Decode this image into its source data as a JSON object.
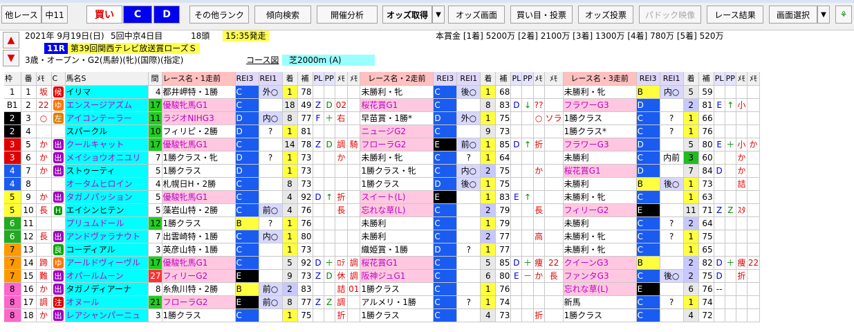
{
  "toolbar": {
    "other_race": "他レース",
    "course_code": "中11",
    "buy": "買い",
    "c": "C",
    "d": "D",
    "other_rank": "その他ランク",
    "trend_search": "傾向検索",
    "meeting_analysis": "開催分析",
    "odds_get": "オッズ取得",
    "odds_screen": "オッズ画面",
    "buy_vote": "買い目・投票",
    "odds_vote": "オッズ投票",
    "paddock": "パドック映像",
    "result": "レース結果",
    "screen_select": "画面選択",
    "dropdown_arrow": "▼"
  },
  "race": {
    "date": "2021年 9月19日(日)",
    "meeting": "5回中京4日目",
    "heads": "18頭",
    "post_time": "15:35発走",
    "race_no": "11R",
    "name": "第39回関西テレビ放送賞ローズＳ",
    "conditions": "3歳・オープン・G2(馬齢)(牝)(国際)(指定)",
    "course_label": "コース図",
    "course": "芝2000m (A)",
    "prize": "本賞金 [1着] 5200万 [2着] 2100万 [3着] 1300万 [4着] 780万 [5着] 520万"
  },
  "headers": [
    "枠",
    "番",
    "ﾒﾓ",
    "C",
    "馬名S",
    "間",
    "レース名・1走前",
    "REI3",
    "REI1",
    "着",
    "補",
    "PL",
    "PP",
    "ﾒﾓ",
    "ﾒﾓ",
    "レース名・2走前",
    "REI3",
    "REI1",
    "着",
    "補",
    "PL",
    "PP",
    "ﾒﾓ",
    "ﾒﾓ",
    "レース名・3走前",
    "REI3",
    "REI1",
    "着",
    "補",
    "PL",
    "PP",
    "ﾒﾓ",
    "ﾒﾓ"
  ],
  "rows": [
    {
      "w": "1",
      "n": "1",
      "m": "坂",
      "c": "候",
      "name": "イリマ",
      "gap": "4",
      "r1": [
        "都井岬特・1勝",
        "C",
        "外○",
        "1",
        "78",
        "",
        "",
        "",
        ""
      ],
      "r2": [
        "未勝利・牝",
        "C",
        "後○",
        "1",
        "68",
        "",
        "",
        "",
        ""
      ],
      "r3": [
        "未勝利・牝",
        "B",
        "内○",
        "5",
        "59",
        "",
        "",
        "",
        ""
      ]
    },
    {
      "w": "B1",
      "n": "2",
      "m": "22",
      "c": "ゆ",
      "name": "エンスージアズム",
      "gap": "17",
      "r1": [
        "優駿牝馬G1",
        "C",
        "",
        "18",
        "49",
        "Z",
        "D",
        "02",
        ""
      ],
      "r2": [
        "桜花賞G1",
        "C",
        "",
        "8",
        "83",
        "D",
        "↓",
        "??",
        ""
      ],
      "r3": [
        "フラワーG3",
        "D",
        "",
        "2",
        "81",
        "E",
        "↑",
        "小",
        ""
      ]
    },
    {
      "w": "2",
      "n": "3",
      "m": "○",
      "c": "左",
      "name": "アイコンテーラー",
      "gap": "11",
      "r1": [
        "ラジオNIHG3",
        "D",
        "内○",
        "8",
        "77",
        "F",
        "＋",
        "右",
        ""
      ],
      "r2": [
        "早苗賞・1勝*",
        "D",
        "外○",
        "1",
        "75",
        "",
        "",
        "○",
        "ソラ"
      ],
      "r3": [
        "1勝クラス",
        "C",
        "?",
        "1",
        "66",
        "",
        "",
        "",
        ""
      ]
    },
    {
      "w": "2",
      "n": "4",
      "m": "",
      "c": "",
      "name": "スパークル",
      "gap": "10",
      "r1": [
        "フィリピ・2勝",
        "D",
        "?",
        "1",
        "81",
        "",
        "",
        "",
        ""
      ],
      "r2": [
        "ニュージG2",
        "C",
        "",
        "9",
        "73",
        "",
        "",
        "",
        ""
      ],
      "r3": [
        "1勝クラス*",
        "C",
        "?",
        "1",
        "76",
        "",
        "",
        "",
        ""
      ]
    },
    {
      "w": "3",
      "n": "5",
      "m": "か",
      "c": "出",
      "name": "クールキャット",
      "gap": "17",
      "r1": [
        "優駿牝馬G1",
        "C",
        "",
        "14",
        "78",
        "Z",
        "D",
        "調",
        "騎"
      ],
      "r2": [
        "フローラG2",
        "E",
        "前○",
        "1",
        "85",
        "D",
        "↑",
        "折",
        ""
      ],
      "r3": [
        "フラワーG3",
        "D",
        "",
        "5",
        "80",
        "E",
        "＋",
        "小",
        "か"
      ]
    },
    {
      "w": "3",
      "n": "6",
      "m": "か",
      "c": "出",
      "name": "メイショウオニユリ",
      "gap": "7",
      "r1": [
        "1勝クラス・牝",
        "D",
        "?",
        "1",
        "73",
        "",
        "",
        "か",
        ""
      ],
      "r2": [
        "未勝利・牝",
        "C",
        "?",
        "1",
        "64",
        "",
        "",
        "",
        ""
      ],
      "r3": [
        "未勝利",
        "C",
        "内前",
        "3",
        "60",
        "",
        "",
        "か",
        ""
      ]
    },
    {
      "w": "4",
      "n": "7",
      "m": "か",
      "c": "出",
      "name": "ストゥーティ",
      "gap": "5",
      "r1": [
        "1勝クラス",
        "D",
        "",
        "1",
        "73",
        "",
        "",
        "",
        ""
      ],
      "r2": [
        "1勝クラス・牝",
        "C",
        "内○",
        "2",
        "75",
        "",
        "",
        "か",
        ""
      ],
      "r3": [
        "桜花賞G1",
        "D",
        "",
        "7",
        "84",
        "D",
        "",
        "か",
        ""
      ]
    },
    {
      "w": "4",
      "n": "8",
      "m": "",
      "c": "",
      "name": "オータムヒロイン",
      "gap": "4",
      "r1": [
        "札幌日H・2勝",
        "C",
        "",
        "8",
        "73",
        "",
        "",
        "",
        ""
      ],
      "r2": [
        "1勝クラス",
        "D",
        "後○",
        "1",
        "75",
        "",
        "",
        "",
        ""
      ],
      "r3": [
        "未勝利",
        "B",
        "後○",
        "1",
        "73",
        "",
        "",
        "詰",
        ""
      ]
    },
    {
      "w": "5",
      "n": "9",
      "m": "か",
      "c": "出",
      "name": "タガノパッション",
      "gap": "5",
      "r1": [
        "優駿牝馬G1",
        "C",
        "",
        "4",
        "92",
        "D",
        "↑",
        "折",
        ""
      ],
      "r2": [
        "スイート(L)",
        "E",
        "",
        "1",
        "83",
        "E",
        "↑",
        "",
        ""
      ],
      "r3": [
        "未勝利・牝",
        "C",
        "",
        "1",
        "63",
        "",
        "",
        "",
        ""
      ]
    },
    {
      "w": "5",
      "n": "10",
      "m": "長",
      "c": "H",
      "name": "エイシンヒテン",
      "gap": "5",
      "r1": [
        "藻岩山特・2勝",
        "C",
        "前○",
        "4",
        "76",
        "",
        "",
        "長",
        ""
      ],
      "r2": [
        "忘れな草(L)",
        "C",
        "",
        "2",
        "79",
        "",
        "",
        "長",
        ""
      ],
      "r3": [
        "フィリーG2",
        "E",
        "",
        "11",
        "71",
        "Z",
        "Z",
        "ｽﾀ",
        ""
      ]
    },
    {
      "w": "6",
      "n": "11",
      "m": "",
      "c": "",
      "name": "プリュムドール",
      "gap": "12",
      "r1": [
        "1勝クラス",
        "B",
        "?",
        "1",
        "76",
        "",
        "",
        "",
        ""
      ],
      "r2": [
        "未勝利",
        "C",
        "",
        "1",
        "79",
        "",
        "",
        "",
        ""
      ],
      "r3": [
        "未勝利",
        "C",
        "?",
        "2",
        "64",
        "",
        "",
        "",
        ""
      ]
    },
    {
      "w": "6",
      "n": "12",
      "m": "長",
      "c": "出",
      "name": "アンドヴァラナウト",
      "gap": "7",
      "r1": [
        "出雲崎特・1勝",
        "C",
        "内○",
        "1",
        "80",
        "",
        "",
        "",
        ""
      ],
      "r2": [
        "未勝利",
        "C",
        "",
        "2",
        "77",
        "",
        "",
        "高",
        ""
      ],
      "r3": [
        "未勝利・牝",
        "C",
        "?",
        "1",
        "75",
        "",
        "",
        "",
        ""
      ]
    },
    {
      "w": "7",
      "n": "13",
      "m": "",
      "c": "良",
      "name": "コーディアル",
      "gap": "3",
      "r1": [
        "英彦山特・1勝",
        "C",
        "",
        "1",
        "73",
        "",
        "",
        "",
        ""
      ],
      "r2": [
        "織姫賞・1勝",
        "D",
        "?",
        "1",
        "77",
        "",
        "",
        "",
        ""
      ],
      "r3": [
        "未勝利・牝",
        "C",
        "",
        "1",
        "65",
        "",
        "",
        "",
        ""
      ]
    },
    {
      "w": "7",
      "n": "14",
      "m": "蹄",
      "c": "ゆ",
      "name": "アールドヴィーヴル",
      "gap": "17",
      "r1": [
        "優駿牝馬G1",
        "C",
        "",
        "5",
        "92",
        "D",
        "＋",
        "ﾛﾃ",
        "調"
      ],
      "r2": [
        "桜花賞G1",
        "C",
        "",
        "5",
        "85",
        "D",
        "＋",
        "痩",
        "22"
      ],
      "r3": [
        "クイーンG3",
        "B",
        "",
        "2",
        "82",
        "D",
        "＋",
        "痩",
        "22"
      ]
    },
    {
      "w": "7",
      "n": "15",
      "m": "難",
      "c": "出",
      "name": "オパールムーン",
      "gap": "27",
      "r1": [
        "フィリーG2",
        "E",
        "",
        "9",
        "73",
        "Z",
        "D",
        "休",
        "調"
      ],
      "r2": [
        "阪神ジュG1",
        "C",
        "",
        "6",
        "80",
        "E",
        "－",
        "か",
        "長"
      ],
      "r3": [
        "ファンタG3",
        "C",
        "後○",
        "2",
        "75",
        "D",
        "",
        "折",
        ""
      ]
    },
    {
      "w": "8",
      "n": "16",
      "m": "か",
      "c": "出",
      "name": "タガノディアーナ",
      "gap": "8",
      "r1": [
        "糸魚川特・2勝",
        "B",
        "前○",
        "2",
        "83",
        "",
        "",
        "詰",
        "01"
      ],
      "r2": [
        "1勝クラス",
        "C",
        "",
        "1",
        "76",
        "",
        "",
        "",
        ""
      ],
      "r3": [
        "忘れな草(L)",
        "E",
        "",
        "6",
        "76",
        "--",
        "",
        "",
        ""
      ]
    },
    {
      "w": "8",
      "n": "17",
      "m": "調",
      "c": "注",
      "name": "オヌール",
      "gap": "21",
      "r1": [
        "フローラG2",
        "E",
        "前○",
        "8",
        "77",
        "Z",
        "Z",
        "調",
        ""
      ],
      "r2": [
        "アルメリ・1勝",
        "C",
        "?",
        "1",
        "74",
        "",
        "",
        "",
        ""
      ],
      "r3": [
        "新馬",
        "C",
        "?",
        "1",
        "74",
        "",
        "",
        "",
        ""
      ]
    },
    {
      "w": "8",
      "n": "18",
      "m": "か",
      "c": "出",
      "name": "レアシャンパーニュ",
      "gap": "3",
      "r1": [
        "1勝クラス",
        "C",
        "",
        "1",
        "75",
        "",
        "",
        "折",
        ""
      ],
      "r2": [
        "1勝クラス",
        "C",
        "",
        "4",
        "73",
        "",
        "",
        "折",
        ""
      ],
      "r3": [
        "1勝クラス",
        "C",
        "",
        "4",
        "72",
        "",
        "",
        "",
        ""
      ]
    }
  ]
}
